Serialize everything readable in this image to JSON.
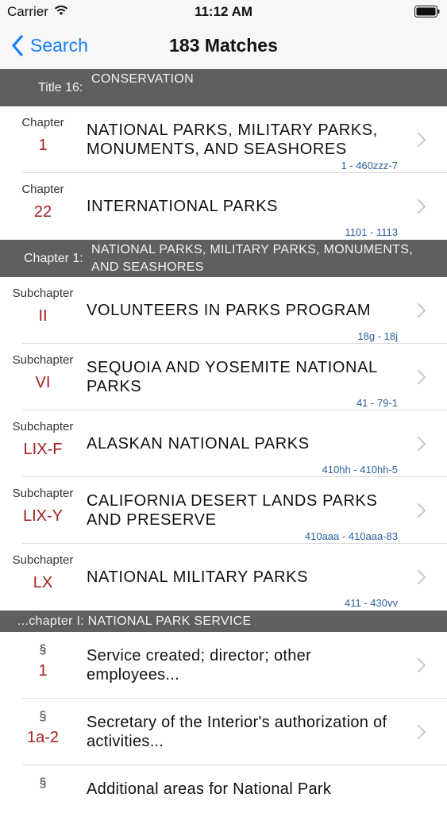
{
  "status_bar": {
    "carrier": "Carrier",
    "time": "11:12 AM",
    "wifi_icon": "wifi-icon",
    "battery_icon": "battery-icon"
  },
  "nav": {
    "back_label": "Search",
    "title": "183 Matches",
    "accent": "#147efb"
  },
  "sections": [
    {
      "lead": "Title 16:",
      "text": "CONSERVATION",
      "rows": [
        {
          "kind": "Chapter",
          "num": "1",
          "title": "NATIONAL PARKS, MILITARY PARKS, MONUMENTS, AND SEASHORES",
          "range": "1 - 460zzz-7"
        },
        {
          "kind": "Chapter",
          "num": "22",
          "title": "INTERNATIONAL PARKS",
          "range": "1101 - 1113"
        }
      ]
    },
    {
      "lead": "Chapter 1:",
      "text": "NATIONAL PARKS, MILITARY PARKS, MONUMENTS, AND SEASHORES",
      "rows": [
        {
          "kind": "Subchapter",
          "num": "II",
          "title": "VOLUNTEERS IN PARKS PROGRAM",
          "range": "18g - 18j"
        },
        {
          "kind": "Subchapter",
          "num": "VI",
          "title": "SEQUOIA AND YOSEMITE NATIONAL PARKS",
          "range": "41 - 79-1"
        },
        {
          "kind": "Subchapter",
          "num": "LIX-F",
          "title": "ALASKAN NATIONAL PARKS",
          "range": "410hh - 410hh-5"
        },
        {
          "kind": "Subchapter",
          "num": "LIX-Y",
          "title": "CALIFORNIA DESERT LANDS PARKS AND PRESERVE",
          "range": "410aaa - 410aaa-83"
        },
        {
          "kind": "Subchapter",
          "num": "LX",
          "title": "NATIONAL MILITARY PARKS",
          "range": "411 - 430vv"
        }
      ]
    },
    {
      "lead": "",
      "text": "...chapter I: NATIONAL PARK SERVICE",
      "rows": [
        {
          "kind": "§",
          "num": "1",
          "title": "Service created; director; other employees...",
          "range": ""
        },
        {
          "kind": "§",
          "num": "1a-2",
          "title": "Secretary of the Interior's authorization of activities...",
          "range": ""
        },
        {
          "kind": "§",
          "num": "",
          "title": "Additional areas for National Park",
          "range": ""
        }
      ]
    }
  ],
  "colors": {
    "section_header_bg": "#5f5f5f",
    "number_red": "#a31f1f",
    "range_blue": "#2b5f9e"
  }
}
